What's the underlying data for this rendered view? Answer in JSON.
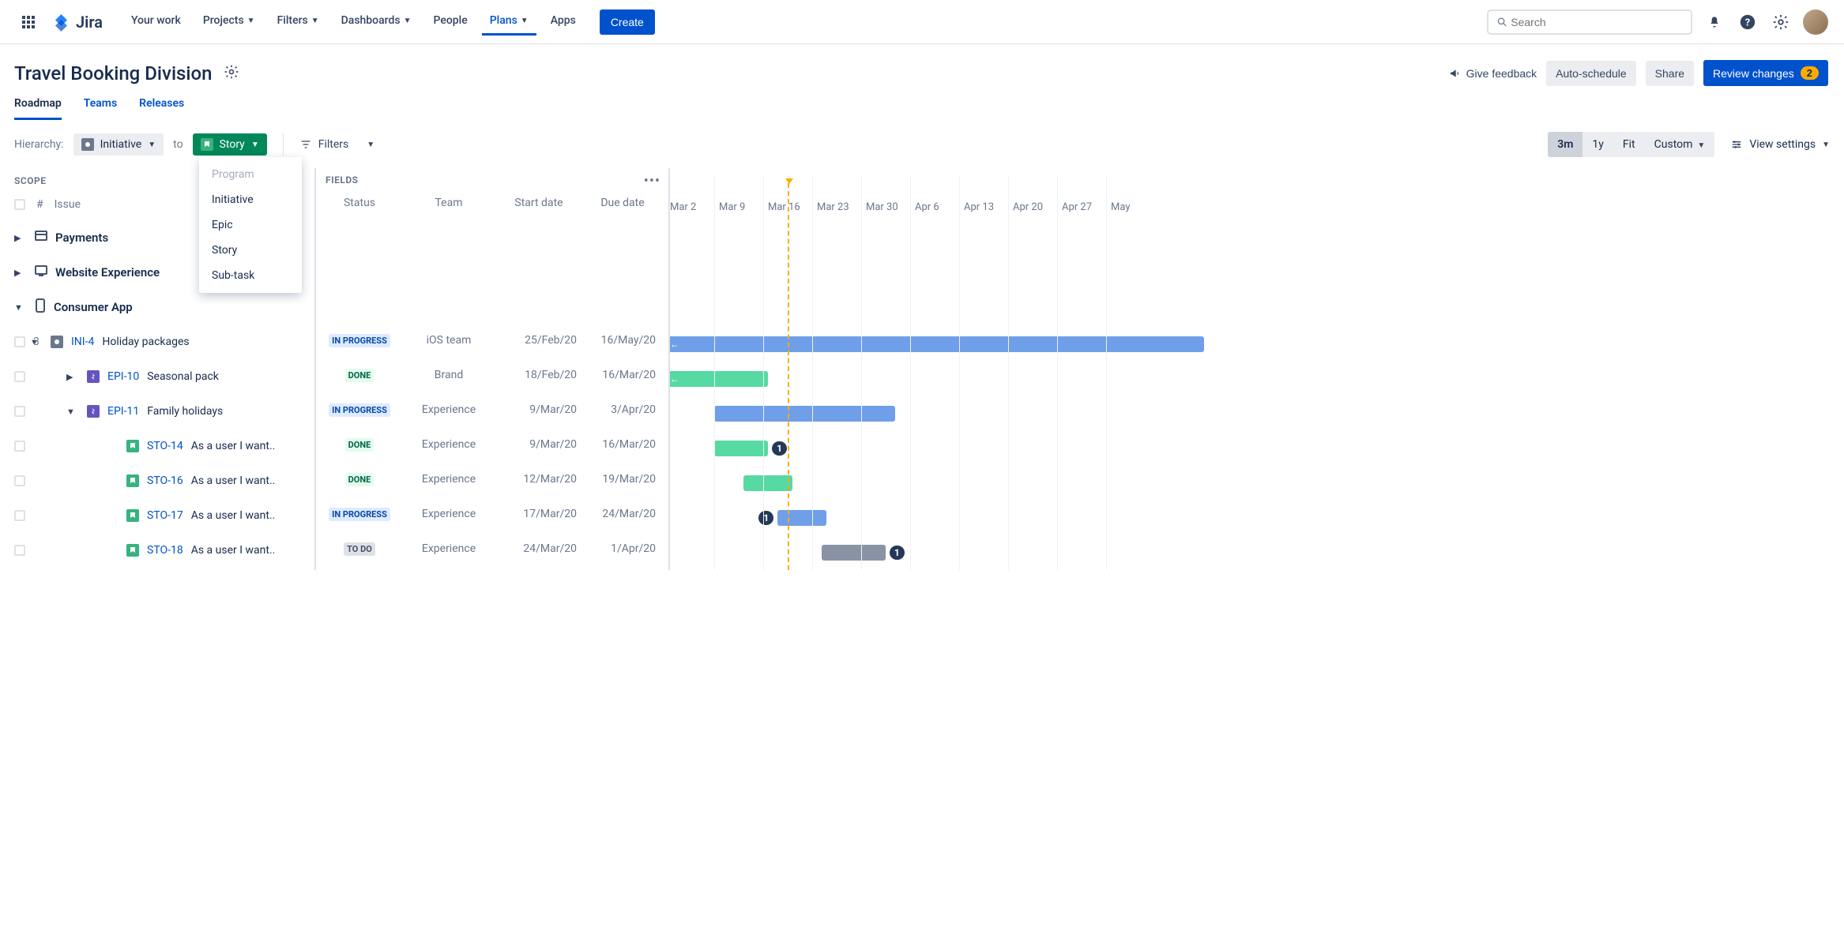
{
  "nav": {
    "product": "Jira",
    "items": [
      "Your work",
      "Projects",
      "Filters",
      "Dashboards",
      "People",
      "Plans",
      "Apps"
    ],
    "active": "Plans",
    "create": "Create",
    "search_placeholder": "Search"
  },
  "plan": {
    "title": "Travel Booking Division",
    "feedback": "Give feedback",
    "auto_schedule": "Auto-schedule",
    "share": "Share",
    "review": "Review changes",
    "review_count": "2"
  },
  "tabs": [
    "Roadmap",
    "Teams",
    "Releases"
  ],
  "active_tab": "Roadmap",
  "hierarchy": {
    "label": "Hierarchy:",
    "from": "Initiative",
    "to_label": "to",
    "to": "Story",
    "dropdown": [
      "Program",
      "Initiative",
      "Epic",
      "Story",
      "Sub-task"
    ]
  },
  "filters_label": "Filters",
  "zoom": {
    "options": [
      "3m",
      "1y",
      "Fit",
      "Custom"
    ],
    "active": "3m"
  },
  "view_settings": "View settings",
  "columns": {
    "scope_label": "SCOPE",
    "fields_label": "FIELDS",
    "hash": "#",
    "issue": "Issue",
    "status": "Status",
    "team": "Team",
    "start": "Start date",
    "due": "Due date"
  },
  "timeline_dates": [
    "Mar 2",
    "Mar 9",
    "Mar 16",
    "Mar 23",
    "Mar 30",
    "Apr 6",
    "Apr 13",
    "Apr 20",
    "Apr 27",
    "May"
  ],
  "today_index": 2.4,
  "groups": [
    {
      "title": "Payments",
      "icon": "payment",
      "expanded": false
    },
    {
      "title": "Website Experience",
      "icon": "website",
      "expanded": false
    },
    {
      "title": "Consumer App",
      "icon": "app",
      "expanded": true
    }
  ],
  "rows": [
    {
      "num": "3",
      "indent": 1,
      "icon": "init",
      "key": "INI-4",
      "summary": "Holiday packages",
      "status": "IN PROGRESS",
      "status_class": "inprogress",
      "team": "iOS team",
      "start": "25/Feb/20",
      "due": "16/May/20",
      "bar": {
        "color": "blue",
        "left": -0.1,
        "width": 11,
        "arrow_left": true
      }
    },
    {
      "indent": 2,
      "icon": "epic",
      "key": "EPI-10",
      "summary": "Seasonal pack",
      "status": "DONE",
      "status_class": "done",
      "team": "Brand",
      "start": "18/Feb/20",
      "due": "16/Mar/20",
      "bar": {
        "color": "green",
        "left": -0.1,
        "width": 2.1,
        "arrow_left": true
      }
    },
    {
      "indent": 2,
      "icon": "epic",
      "key": "EPI-11",
      "summary": "Family holidays",
      "status": "IN PROGRESS",
      "status_class": "inprogress",
      "team": "Experience",
      "start": "9/Mar/20",
      "due": "3/Apr/20",
      "bar": {
        "color": "blue",
        "left": 0.9,
        "width": 3.7
      }
    },
    {
      "indent": 3,
      "icon": "story",
      "key": "STO-14",
      "summary": "As a user I want..",
      "status": "DONE",
      "status_class": "done",
      "team": "Experience",
      "start": "9/Mar/20",
      "due": "16/Mar/20",
      "bar": {
        "color": "green",
        "left": 0.9,
        "width": 1.1,
        "dep_right": "1"
      }
    },
    {
      "indent": 3,
      "icon": "story",
      "key": "STO-16",
      "summary": "As a user I want..",
      "status": "DONE",
      "status_class": "done",
      "team": "Experience",
      "start": "12/Mar/20",
      "due": "19/Mar/20",
      "bar": {
        "color": "green",
        "left": 1.5,
        "width": 1.0
      }
    },
    {
      "indent": 3,
      "icon": "story",
      "key": "STO-17",
      "summary": "As a user I want..",
      "status": "IN PROGRESS",
      "status_class": "inprogress",
      "team": "Experience",
      "start": "17/Mar/20",
      "due": "24/Mar/20",
      "bar": {
        "color": "blue",
        "left": 2.2,
        "width": 1.0,
        "dep_left": "1"
      }
    },
    {
      "indent": 3,
      "icon": "story",
      "key": "STO-18",
      "summary": "As a user I want..",
      "status": "TO DO",
      "status_class": "todo",
      "team": "Experience",
      "start": "24/Mar/20",
      "due": "1/Apr/20",
      "bar": {
        "color": "grey",
        "left": 3.1,
        "width": 1.3,
        "dep_right": "1"
      }
    }
  ]
}
